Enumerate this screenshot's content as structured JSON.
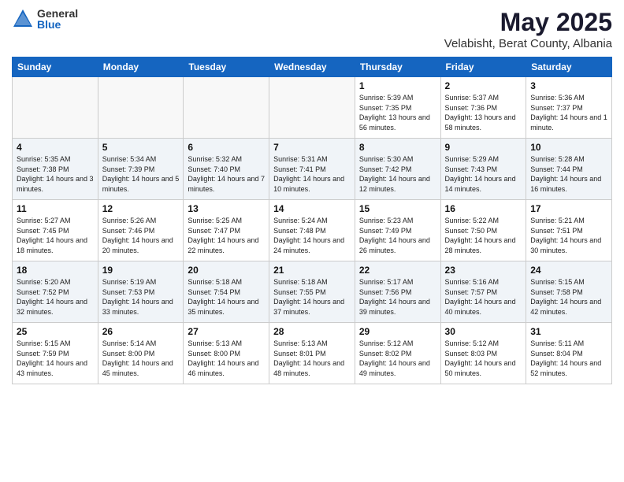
{
  "logo": {
    "general": "General",
    "blue": "Blue"
  },
  "title": "May 2025",
  "location": "Velabisht, Berat County, Albania",
  "days_of_week": [
    "Sunday",
    "Monday",
    "Tuesday",
    "Wednesday",
    "Thursday",
    "Friday",
    "Saturday"
  ],
  "weeks": [
    [
      {
        "day": "",
        "info": ""
      },
      {
        "day": "",
        "info": ""
      },
      {
        "day": "",
        "info": ""
      },
      {
        "day": "",
        "info": ""
      },
      {
        "day": "1",
        "info": "Sunrise: 5:39 AM\nSunset: 7:35 PM\nDaylight: 13 hours\nand 56 minutes."
      },
      {
        "day": "2",
        "info": "Sunrise: 5:37 AM\nSunset: 7:36 PM\nDaylight: 13 hours\nand 58 minutes."
      },
      {
        "day": "3",
        "info": "Sunrise: 5:36 AM\nSunset: 7:37 PM\nDaylight: 14 hours\nand 1 minute."
      }
    ],
    [
      {
        "day": "4",
        "info": "Sunrise: 5:35 AM\nSunset: 7:38 PM\nDaylight: 14 hours\nand 3 minutes."
      },
      {
        "day": "5",
        "info": "Sunrise: 5:34 AM\nSunset: 7:39 PM\nDaylight: 14 hours\nand 5 minutes."
      },
      {
        "day": "6",
        "info": "Sunrise: 5:32 AM\nSunset: 7:40 PM\nDaylight: 14 hours\nand 7 minutes."
      },
      {
        "day": "7",
        "info": "Sunrise: 5:31 AM\nSunset: 7:41 PM\nDaylight: 14 hours\nand 10 minutes."
      },
      {
        "day": "8",
        "info": "Sunrise: 5:30 AM\nSunset: 7:42 PM\nDaylight: 14 hours\nand 12 minutes."
      },
      {
        "day": "9",
        "info": "Sunrise: 5:29 AM\nSunset: 7:43 PM\nDaylight: 14 hours\nand 14 minutes."
      },
      {
        "day": "10",
        "info": "Sunrise: 5:28 AM\nSunset: 7:44 PM\nDaylight: 14 hours\nand 16 minutes."
      }
    ],
    [
      {
        "day": "11",
        "info": "Sunrise: 5:27 AM\nSunset: 7:45 PM\nDaylight: 14 hours\nand 18 minutes."
      },
      {
        "day": "12",
        "info": "Sunrise: 5:26 AM\nSunset: 7:46 PM\nDaylight: 14 hours\nand 20 minutes."
      },
      {
        "day": "13",
        "info": "Sunrise: 5:25 AM\nSunset: 7:47 PM\nDaylight: 14 hours\nand 22 minutes."
      },
      {
        "day": "14",
        "info": "Sunrise: 5:24 AM\nSunset: 7:48 PM\nDaylight: 14 hours\nand 24 minutes."
      },
      {
        "day": "15",
        "info": "Sunrise: 5:23 AM\nSunset: 7:49 PM\nDaylight: 14 hours\nand 26 minutes."
      },
      {
        "day": "16",
        "info": "Sunrise: 5:22 AM\nSunset: 7:50 PM\nDaylight: 14 hours\nand 28 minutes."
      },
      {
        "day": "17",
        "info": "Sunrise: 5:21 AM\nSunset: 7:51 PM\nDaylight: 14 hours\nand 30 minutes."
      }
    ],
    [
      {
        "day": "18",
        "info": "Sunrise: 5:20 AM\nSunset: 7:52 PM\nDaylight: 14 hours\nand 32 minutes."
      },
      {
        "day": "19",
        "info": "Sunrise: 5:19 AM\nSunset: 7:53 PM\nDaylight: 14 hours\nand 33 minutes."
      },
      {
        "day": "20",
        "info": "Sunrise: 5:18 AM\nSunset: 7:54 PM\nDaylight: 14 hours\nand 35 minutes."
      },
      {
        "day": "21",
        "info": "Sunrise: 5:18 AM\nSunset: 7:55 PM\nDaylight: 14 hours\nand 37 minutes."
      },
      {
        "day": "22",
        "info": "Sunrise: 5:17 AM\nSunset: 7:56 PM\nDaylight: 14 hours\nand 39 minutes."
      },
      {
        "day": "23",
        "info": "Sunrise: 5:16 AM\nSunset: 7:57 PM\nDaylight: 14 hours\nand 40 minutes."
      },
      {
        "day": "24",
        "info": "Sunrise: 5:15 AM\nSunset: 7:58 PM\nDaylight: 14 hours\nand 42 minutes."
      }
    ],
    [
      {
        "day": "25",
        "info": "Sunrise: 5:15 AM\nSunset: 7:59 PM\nDaylight: 14 hours\nand 43 minutes."
      },
      {
        "day": "26",
        "info": "Sunrise: 5:14 AM\nSunset: 8:00 PM\nDaylight: 14 hours\nand 45 minutes."
      },
      {
        "day": "27",
        "info": "Sunrise: 5:13 AM\nSunset: 8:00 PM\nDaylight: 14 hours\nand 46 minutes."
      },
      {
        "day": "28",
        "info": "Sunrise: 5:13 AM\nSunset: 8:01 PM\nDaylight: 14 hours\nand 48 minutes."
      },
      {
        "day": "29",
        "info": "Sunrise: 5:12 AM\nSunset: 8:02 PM\nDaylight: 14 hours\nand 49 minutes."
      },
      {
        "day": "30",
        "info": "Sunrise: 5:12 AM\nSunset: 8:03 PM\nDaylight: 14 hours\nand 50 minutes."
      },
      {
        "day": "31",
        "info": "Sunrise: 5:11 AM\nSunset: 8:04 PM\nDaylight: 14 hours\nand 52 minutes."
      }
    ]
  ]
}
